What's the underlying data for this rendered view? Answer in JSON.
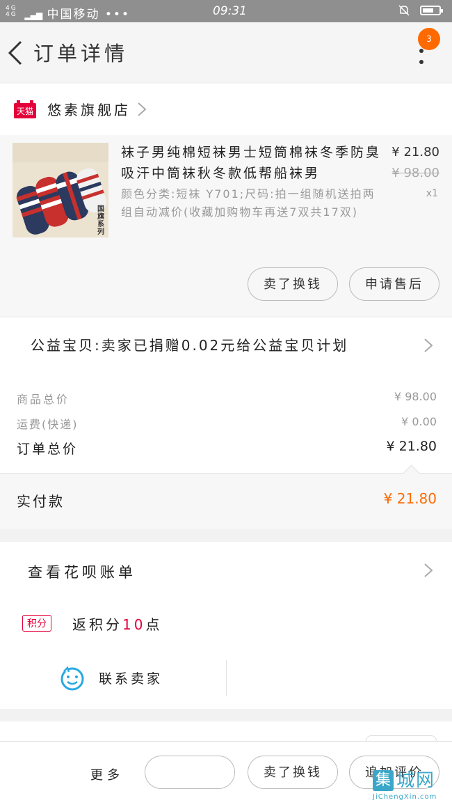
{
  "status_bar": {
    "network": "4G 4G",
    "carrier": "中国移动",
    "dots": "•••",
    "time": "09:31",
    "battery_level": 0.7
  },
  "header": {
    "title": "订单详情",
    "badge_count": "3"
  },
  "store": {
    "platform_icon": "天猫",
    "name": "悠素旗舰店"
  },
  "product": {
    "image_caption": "国旗系列",
    "title": "袜子男纯棉短袜男士短筒棉袜冬季防臭吸汗中筒袜秋冬款低帮船袜男",
    "spec": "颜色分类:短袜 Y701;尺码:拍一组随机送拍两组自动减价(收藏加购物车再送7双共17双)",
    "price": "¥ 21.80",
    "original_price": "¥ 98.00",
    "quantity": "x1",
    "buttons": {
      "resell": "卖了换钱",
      "after_sale": "申请售后"
    }
  },
  "charity": {
    "text": "公益宝贝:卖家已捐赠0.02元给公益宝贝计划"
  },
  "summary": {
    "goods_total_label": "商品总价",
    "goods_total_value": "¥ 98.00",
    "shipping_label": "运费(快递)",
    "shipping_value": "¥ 0.00",
    "order_total_label": "订单总价",
    "order_total_value": "¥ 21.80",
    "paid_label": "实付款",
    "paid_value": "¥ 21.80"
  },
  "huabei": {
    "label": "查看花呗账单"
  },
  "points": {
    "badge": "积分",
    "text_before": "返积分",
    "number": "10",
    "text_after": "点"
  },
  "contact": {
    "label": "联系卖家"
  },
  "footer": {
    "more": "更多",
    "resell": "卖了换钱",
    "review": "追加评价"
  },
  "watermark": {
    "box_char": "集",
    "rest": "城网",
    "sub": "JiChengXin.com"
  },
  "colors": {
    "accent": "#ff6a00",
    "points_red": "#e4003a",
    "watermark": "#3aa7c9"
  },
  "icons": [
    "back-arrow-icon",
    "more-dots-icon",
    "tmall-icon",
    "chevron-right-icon",
    "smiley-chat-icon"
  ]
}
